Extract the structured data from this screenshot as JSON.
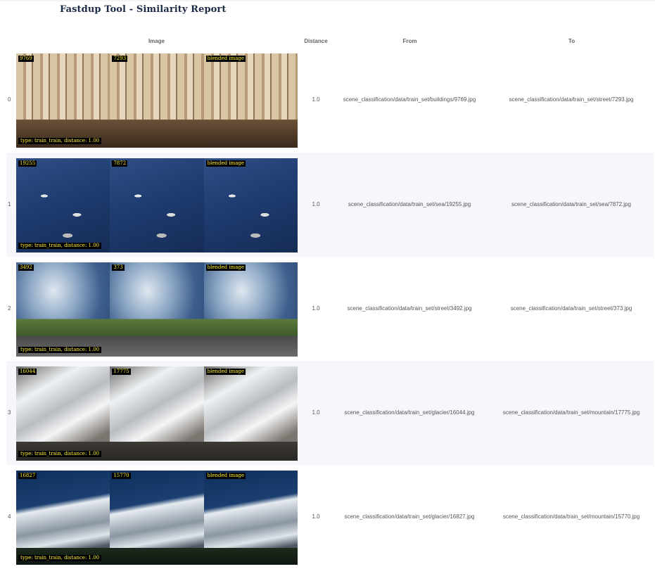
{
  "report": {
    "title": "Fastdup Tool - Similarity Report",
    "columns": {
      "image": "Image",
      "distance": "Distance",
      "from": "From",
      "to": "To"
    },
    "blended_label": "blended image",
    "rows": [
      {
        "index": "0",
        "scene": "buildings",
        "id_from": "9769",
        "id_to": "7293",
        "caption": "type: train_train, distance: 1.00",
        "distance": "1.0",
        "from": "scene_classification/data/train_set/buildings/9769.jpg",
        "to": "scene_classification/data/train_set/street/7293.jpg"
      },
      {
        "index": "1",
        "scene": "sea",
        "id_from": "19255",
        "id_to": "7872",
        "caption": "type: train_train, distance: 1.00",
        "distance": "1.0",
        "from": "scene_classification/data/train_set/sea/19255.jpg",
        "to": "scene_classification/data/train_set/sea/7872.jpg"
      },
      {
        "index": "2",
        "scene": "street",
        "id_from": "3492",
        "id_to": "373",
        "caption": "type: train_train, distance: 1.00",
        "distance": "1.0",
        "from": "scene_classification/data/train_set/street/3492.jpg",
        "to": "scene_classification/data/train_set/street/373.jpg"
      },
      {
        "index": "3",
        "scene": "glacier",
        "id_from": "16044",
        "id_to": "17775",
        "caption": "type: train_train, distance: 1.00",
        "distance": "1.0",
        "from": "scene_classification/data/train_set/glacier/16044.jpg",
        "to": "scene_classification/data/train_set/mountain/17775.jpg"
      },
      {
        "index": "4",
        "scene": "mountain",
        "id_from": "16827",
        "id_to": "15770",
        "caption": "type: train_train, distance: 1.00",
        "distance": "1.0",
        "from": "scene_classification/data/train_set/glacier/16827.jpg",
        "to": "scene_classification/data/train_set/mountain/15770.jpg"
      }
    ]
  }
}
